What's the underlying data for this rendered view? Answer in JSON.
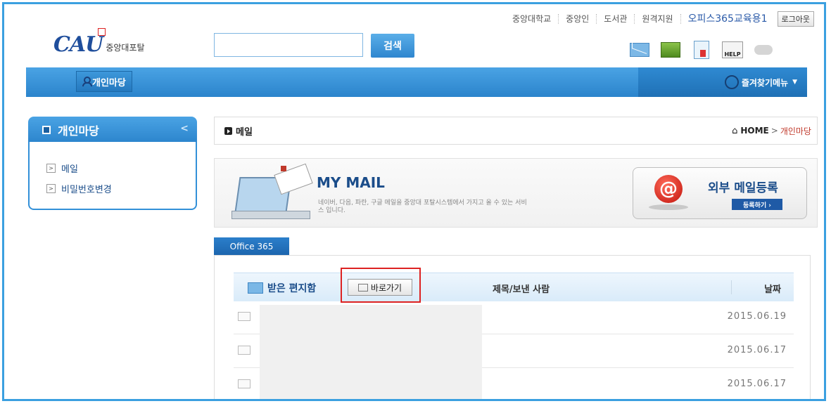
{
  "top_links": [
    "중앙대학교",
    "중앙인",
    "도서관",
    "원격지원"
  ],
  "office365_link": "오피스365교육용1",
  "logout_label": "로그아웃",
  "logo": {
    "mark": "CAU",
    "name": "중앙대포탈"
  },
  "search": {
    "value": "",
    "placeholder": "",
    "button_label": "검색"
  },
  "header_icons": [
    "mail-icon",
    "box-icon",
    "document-icon",
    "help-icon",
    "cloud-icon"
  ],
  "help_text": "HELP",
  "nav": {
    "tab_label": "개인마당",
    "favorites_label": "즐겨찾기메뉴",
    "favorites_arrow": "▼"
  },
  "sidebar": {
    "title": "개인마당",
    "collapse": "<",
    "items": [
      {
        "label": "메일",
        "bullet": ">"
      },
      {
        "label": "비밀번호변경",
        "bullet": ">"
      }
    ]
  },
  "breadcrumb": {
    "page_title": "메일",
    "home_glyph": "⌂",
    "home": "HOME",
    "separator": ">",
    "current": "개인마당"
  },
  "banner": {
    "title": "MY MAIL",
    "description": "네이버, 다음, 파란, 구글 메일을 중앙대 포탈시스템에서 가지고 올 수 있는 서비스 입니다.",
    "ext_label": "외부 메일등록",
    "register_button": "등록하기 ›",
    "at_symbol": "@"
  },
  "office_tab": "Office 365",
  "table": {
    "inbox_label": "받은 편지함",
    "goto_label": "바로가기",
    "subject_header": "제목/보낸 사람",
    "date_header": "날짜",
    "rows": [
      {
        "date": "2015.06.19"
      },
      {
        "date": "2015.06.17"
      },
      {
        "date": "2015.06.17"
      }
    ]
  },
  "colors": {
    "accent": "#2b84cc",
    "frame": "#3ba0e0",
    "highlight": "#dd2222"
  }
}
